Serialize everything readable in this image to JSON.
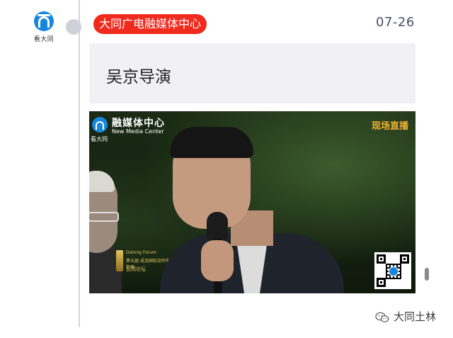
{
  "account": {
    "logo_icon": "tower-arch-icon",
    "logo_caption": "看大同"
  },
  "post": {
    "source_badge": "大同广电融媒体中心",
    "badge_color": "#f02b1e",
    "date": "07-26",
    "title": "吴京导演"
  },
  "video": {
    "brand_title": "融媒体中心",
    "brand_subtitle": "New Media Center",
    "brand_caption": "看大同",
    "live_label": "现场直播",
    "caption_line1": "Datong Forum",
    "caption_line2": "第五届 成龙国际动作电影周",
    "caption_line3": "云冈论坛",
    "qr_icon": "qr-code-icon"
  },
  "watermark": {
    "icon": "wechat-icon",
    "text": "大同土林"
  }
}
